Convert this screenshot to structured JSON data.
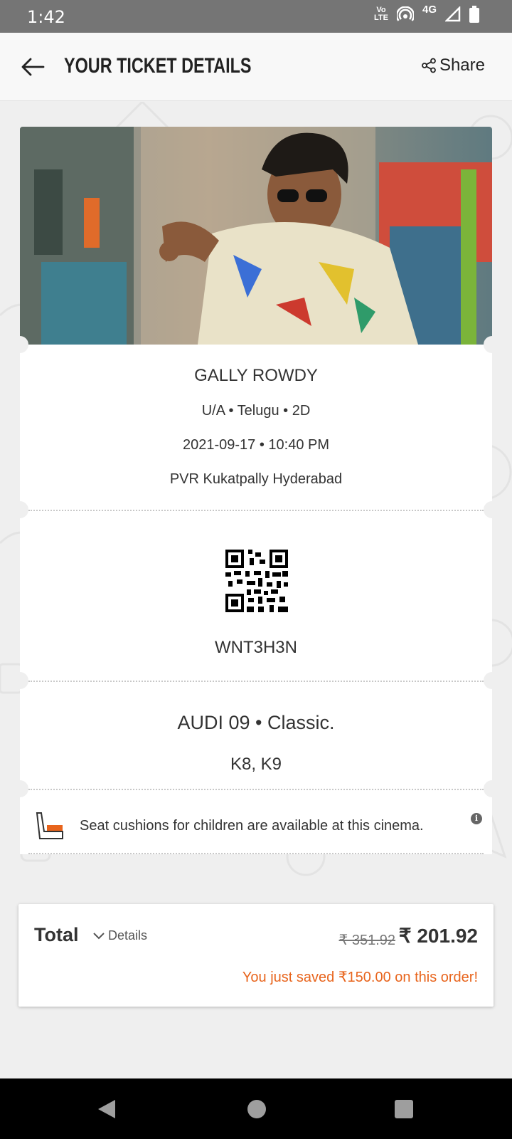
{
  "status_bar": {
    "time": "1:42",
    "volte_top": "Vo",
    "volte_bottom": "LTE",
    "network": "4G"
  },
  "header": {
    "title": "YOUR TICKET DETAILS",
    "share_label": "Share"
  },
  "ticket": {
    "movie_title": "GALLY ROWDY",
    "meta": "U/A • Telugu • 2D",
    "datetime": "2021-09-17 • 10:40 PM",
    "venue": "PVR Kukatpally Hyderabad",
    "booking_id": "WNT3H3N",
    "audi": "AUDI 09 • Classic.",
    "seats": "K8, K9",
    "note": "Seat cushions for children are available at this cinema.",
    "info_icon": "i"
  },
  "total": {
    "label": "Total",
    "details_label": "Details",
    "original_price": "₹ 351.92",
    "final_price": "₹ 201.92",
    "savings_text": "You just saved ₹150.00 on this order!"
  },
  "colors": {
    "accent": "#e8641c",
    "status_bar": "#757575",
    "background": "#efefef"
  }
}
